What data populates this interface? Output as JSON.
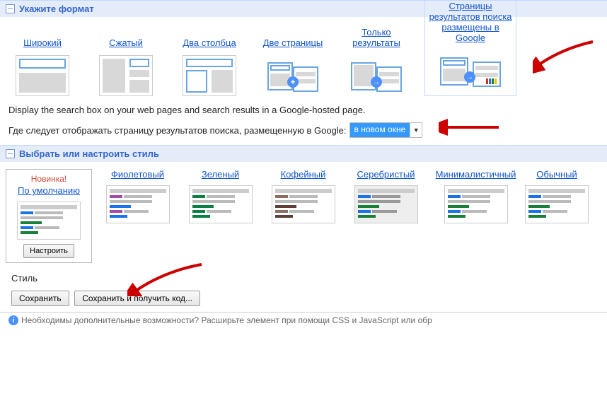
{
  "sections": {
    "format_title": "Укажите формат",
    "style_title": "Выбрать или настроить стиль"
  },
  "formats": {
    "wide": "Широкий",
    "compact": "Сжатый",
    "two_cols": "Два столбца",
    "two_pages": "Две страницы",
    "results_only": "Только результаты",
    "google_hosted": "Страницы результатов поиска размещены в Google"
  },
  "desc": "Display the search box on your web pages and search results in a Google-hosted page.",
  "question": "Где следует отображать страницу результатов поиска, размещенную в Google:",
  "dropdown_value": "в новом окне",
  "new_label": "Новинка!",
  "styles": {
    "default": "По умолчанию",
    "purple": "Фиолетовый",
    "green": "Зеленый",
    "coffee": "Кофейный",
    "silver": "Серебристый",
    "minimal": "Минималистичный",
    "plain": "Обычный"
  },
  "customize_button": "Настроить",
  "style_label": "Стиль",
  "buttons": {
    "save": "Сохранить",
    "save_get_code": "Сохранить и получить код..."
  },
  "footer_hint": "Необходимы дополнительные возможности? Расширьте элемент при помощи CSS и JavaScript или обр"
}
